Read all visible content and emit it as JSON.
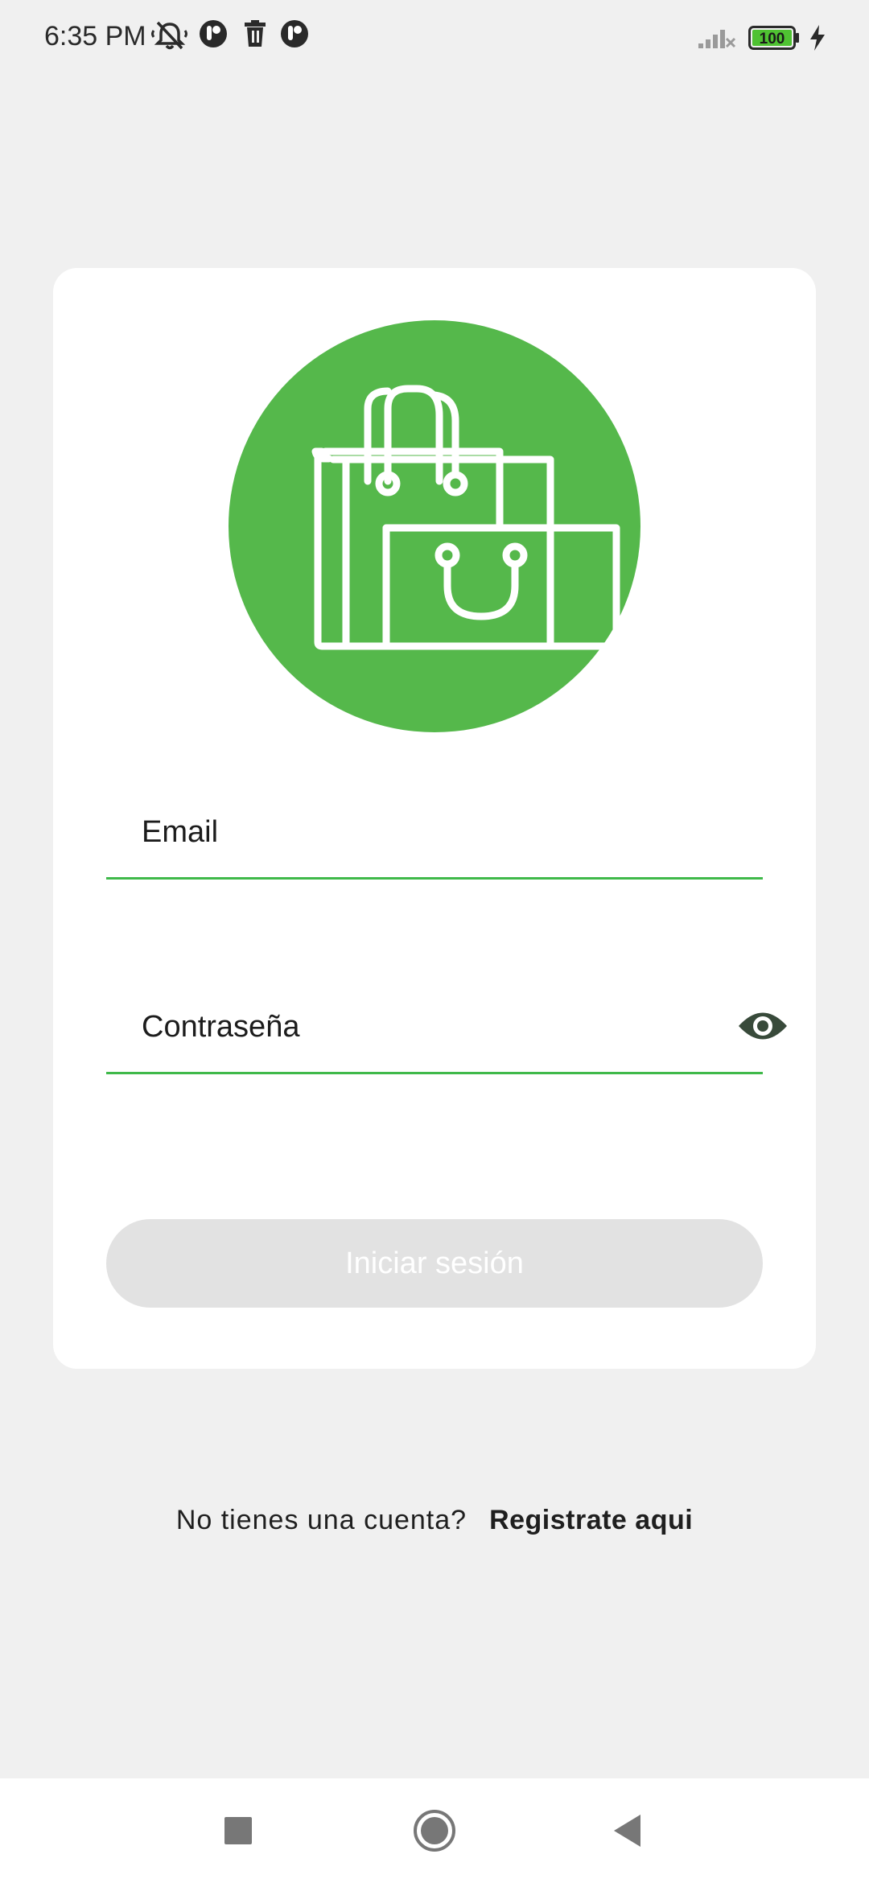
{
  "status_bar": {
    "time": "6:35 PM",
    "battery_level": "100",
    "icons": [
      "mute-icon",
      "app-notification-icon",
      "trash-icon",
      "app-notification-icon",
      "signal-icon",
      "battery-icon",
      "charging-icon"
    ]
  },
  "logo": {
    "icon": "shopping-bags-icon",
    "color": "#55b84b"
  },
  "form": {
    "email_label": "Email",
    "password_label": "Contraseña",
    "password_toggle_icon": "eye-icon",
    "submit_label": "Iniciar sesión",
    "accent_color": "#3fb94a"
  },
  "signup": {
    "prompt": "No tienes una cuenta?",
    "link_label": "Registrate aqui"
  },
  "nav_bar": {
    "buttons": [
      "recents-icon",
      "home-icon",
      "back-icon"
    ]
  }
}
